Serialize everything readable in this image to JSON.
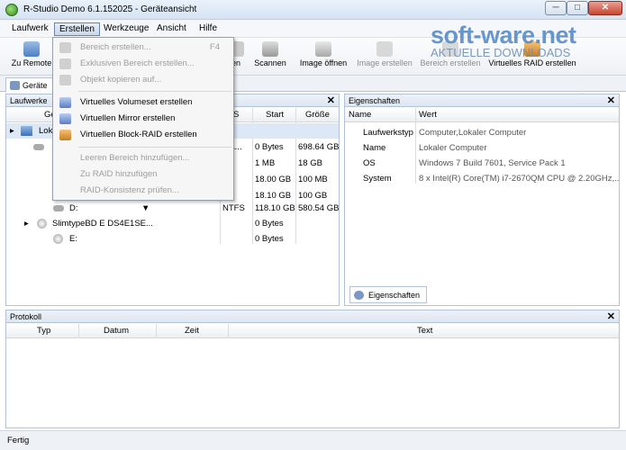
{
  "window": {
    "title": "R-Studio Demo 6.1.152025 - Geräteansicht",
    "minimize_label": "─",
    "maximize_label": "□",
    "close_label": "✕"
  },
  "menu": [
    "Laufwerk",
    "Erstellen",
    "Werkzeuge",
    "Ansicht",
    "Hilfe"
  ],
  "toolbar": {
    "items": [
      {
        "label": "Zu Remote",
        "icon": "remote-computer-icon"
      },
      {
        "label": "en",
        "icon": "scan-partial-icon"
      },
      {
        "label": "Scannen",
        "icon": "scan-icon"
      },
      {
        "label": "Image öffnen",
        "icon": "open-image-icon"
      },
      {
        "label": "Image erstellen",
        "icon": "create-image-icon"
      },
      {
        "label": "Bereich erstellen",
        "icon": "create-region-icon"
      },
      {
        "label": "Virtuelles RAID erstellen",
        "icon": "virtual-raid-icon"
      }
    ],
    "more_label": "»"
  },
  "watermark": {
    "line1": "soft-ware.net",
    "line2": "AKTUELLE DOWNLOADS"
  },
  "tabs": {
    "device_tab": "Geräte"
  },
  "drives_pane": {
    "title": "Laufwerke",
    "close": "✕",
    "columns": [
      "Ge",
      "S",
      "Start",
      "Größe"
    ],
    "rows": [
      {
        "name": "Lok",
        "fs": "",
        "start": "",
        "size": ""
      },
      {
        "name": "",
        "fs": "SA...",
        "start": "0 Bytes",
        "size": "698.64 GB"
      },
      {
        "name": "",
        "fs": "FS",
        "start": "1 MB",
        "size": "18 GB"
      },
      {
        "name": "",
        "fs": "FS",
        "start": "18.00 GB",
        "size": "100 MB"
      },
      {
        "name": "",
        "fs": "FS",
        "start": "18.10 GB",
        "size": "100 GB"
      },
      {
        "name": "D:",
        "fs": "NTFS",
        "start": "118.10 GB",
        "size": "580.54 GB"
      },
      {
        "name": "SlimtypeBD E DS4E1SE...",
        "fs": "",
        "start": "0 Bytes",
        "size": ""
      },
      {
        "name": "E:",
        "fs": "",
        "start": "0 Bytes",
        "size": ""
      }
    ]
  },
  "properties_pane": {
    "title": "Eigenschaften",
    "close": "✕",
    "columns": [
      "Name",
      "Wert"
    ],
    "rows": [
      {
        "name": "Laufwerkstyp",
        "value": "Computer,Lokaler Computer"
      },
      {
        "name": "Name",
        "value": "Lokaler Computer"
      },
      {
        "name": "OS",
        "value": "Windows 7 Build 7601, Service Pack 1"
      },
      {
        "name": "System",
        "value": "8 x Intel(R) Core(TM) i7-2670QM CPU @ 2.20GHz,..."
      }
    ],
    "tab_label": "Eigenschaften"
  },
  "log_pane": {
    "title": "Protokoll",
    "close": "✕",
    "columns": [
      "Typ",
      "Datum",
      "Zeit",
      "Text"
    ]
  },
  "status": "Fertig",
  "dropdown": {
    "items": [
      {
        "label": "Bereich erstellen...",
        "shortcut": "F4",
        "enabled": false,
        "icon": "region-icon"
      },
      {
        "label": "Exklusiven Bereich erstellen...",
        "shortcut": "",
        "enabled": false,
        "icon": "exclusive-region-icon"
      },
      {
        "label": "Objekt kopieren auf...",
        "shortcut": "",
        "enabled": false,
        "icon": "copy-object-icon"
      },
      {
        "label": "Virtuelles Volumeset erstellen",
        "shortcut": "",
        "enabled": true,
        "icon": "volumeset-icon"
      },
      {
        "label": "Virtuellen Mirror erstellen",
        "shortcut": "",
        "enabled": true,
        "icon": "mirror-icon"
      },
      {
        "label": "Virtuellen Block-RAID erstellen",
        "shortcut": "",
        "enabled": true,
        "icon": "block-raid-icon"
      },
      {
        "label": "Leeren Bereich hinzufügen...",
        "shortcut": "",
        "enabled": false,
        "icon": ""
      },
      {
        "label": "Zu RAID hinzufügen",
        "shortcut": "",
        "enabled": false,
        "icon": ""
      },
      {
        "label": "RAID-Konsistenz prüfen...",
        "shortcut": "",
        "enabled": false,
        "icon": ""
      }
    ]
  }
}
